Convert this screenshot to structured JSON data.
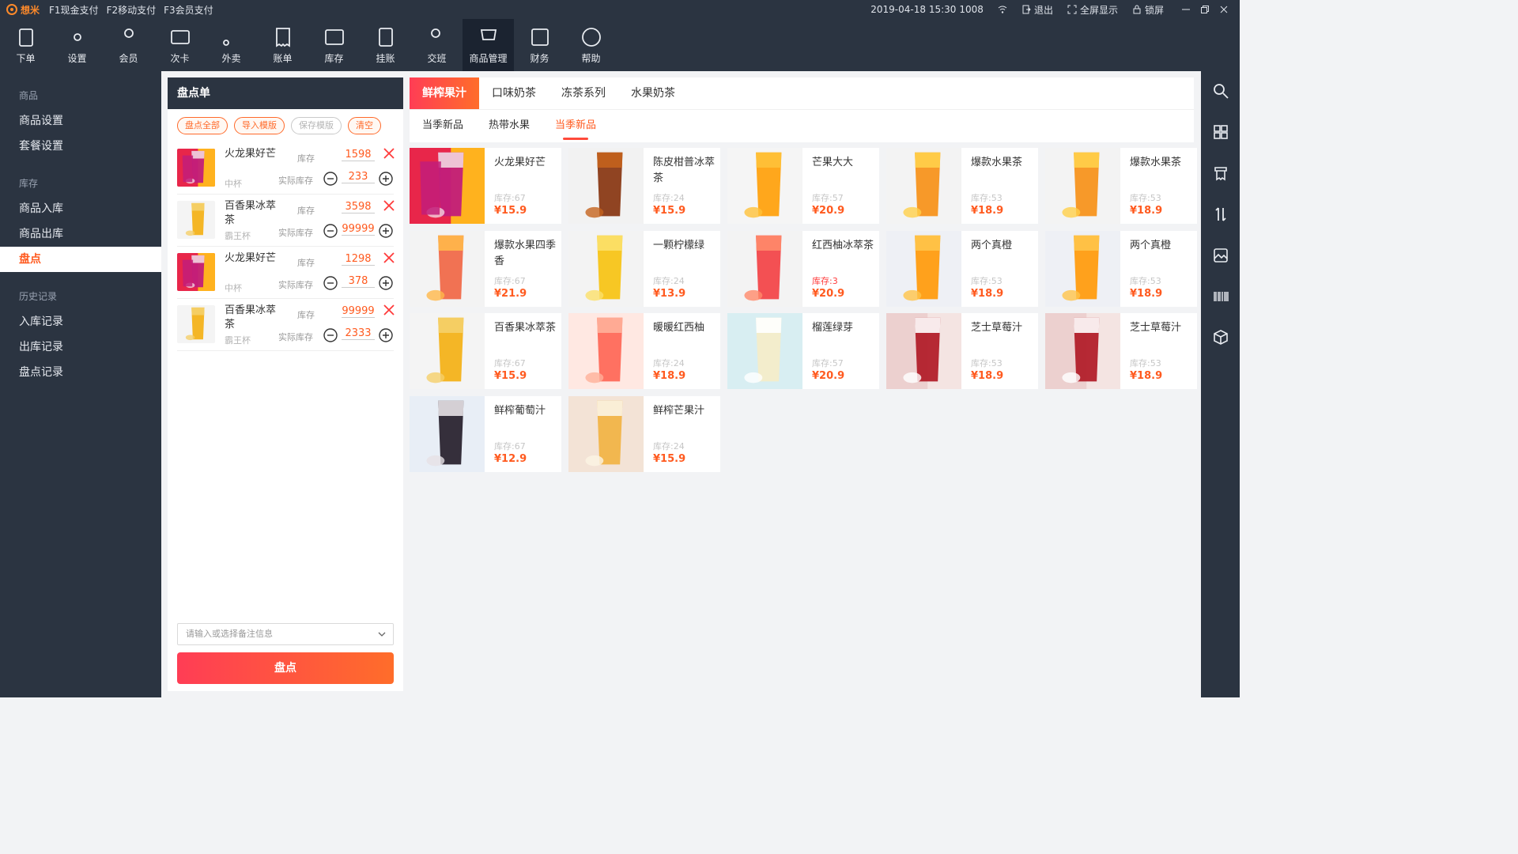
{
  "app": {
    "brand": "想米"
  },
  "topbar": {
    "pay_options": [
      "F1现金支付",
      "F2移动支付",
      "F3会员支付"
    ],
    "datetime": "2019-04-18 15:30",
    "terminal_id": "1008",
    "logout": "退出",
    "fullscreen": "全屏显示",
    "lock": "锁屏"
  },
  "toolbar": [
    {
      "label": "下单",
      "icon": "clipboard-icon"
    },
    {
      "label": "设置",
      "icon": "gear-icon"
    },
    {
      "label": "会员",
      "icon": "user-icon"
    },
    {
      "label": "次卡",
      "icon": "card-icon"
    },
    {
      "label": "外卖",
      "icon": "scooter-icon"
    },
    {
      "label": "账单",
      "icon": "bill-icon"
    },
    {
      "label": "库存",
      "icon": "box-icon"
    },
    {
      "label": "挂账",
      "icon": "ledger-icon"
    },
    {
      "label": "交班",
      "icon": "shift-icon"
    },
    {
      "label": "商品管理",
      "icon": "goods-icon"
    },
    {
      "label": "财务",
      "icon": "finance-icon"
    },
    {
      "label": "帮助",
      "icon": "help-icon"
    }
  ],
  "sidebar": {
    "groups": [
      {
        "title": "商品",
        "items": [
          "商品设置",
          "套餐设置"
        ]
      },
      {
        "title": "库存",
        "items": [
          "商品入库",
          "商品出库",
          "盘点"
        ]
      },
      {
        "title": "历史记录",
        "items": [
          "入库记录",
          "出库记录",
          "盘点记录"
        ]
      }
    ],
    "active": "盘点"
  },
  "panel": {
    "title": "盘点单",
    "buttons": [
      "盘点全部",
      "导入模版",
      "保存模版",
      "清空"
    ],
    "stock_label": "库存",
    "actual_label": "实际库存",
    "rows": [
      {
        "name": "火龙果好芒",
        "spec": "中杯",
        "stock": "1598",
        "actual": "233",
        "img": "pitaya"
      },
      {
        "name": "百香果冰萃茶",
        "spec": "霸王杯",
        "stock": "3598",
        "actual": "99999",
        "img": "passion"
      },
      {
        "name": "火龙果好芒",
        "spec": "中杯",
        "stock": "1298",
        "actual": "378",
        "img": "pitaya"
      },
      {
        "name": "百香果冰萃茶",
        "spec": "霸王杯",
        "stock": "99999",
        "actual": "2333",
        "img": "passion"
      }
    ],
    "remark_placeholder": "请输入或选择备注信息",
    "submit": "盘点"
  },
  "categories": [
    "鲜榨果汁",
    "口味奶茶",
    "冻茶系列",
    "水果奶茶"
  ],
  "active_category": "鲜榨果汁",
  "subcategories": [
    "当季新品",
    "热带水果",
    "当季新品"
  ],
  "active_subcategory_index": 2,
  "products": [
    {
      "name": "火龙果好芒",
      "stock": "库存:67",
      "price": "¥15.9",
      "img": "pitaya"
    },
    {
      "name": "陈皮柑普冰萃茶",
      "stock": "库存:24",
      "price": "¥15.9",
      "img": "tea"
    },
    {
      "name": "芒果大大",
      "stock": "库存:57",
      "price": "¥20.9",
      "img": "mango"
    },
    {
      "name": "爆款水果茶",
      "stock": "库存:53",
      "price": "¥18.9",
      "img": "fruittea"
    },
    {
      "name": "爆款水果茶",
      "stock": "库存:53",
      "price": "¥18.9",
      "img": "fruittea"
    },
    {
      "name": "爆款水果四季香",
      "stock": "库存:67",
      "price": "¥21.9",
      "img": "fourseason"
    },
    {
      "name": "一颗柠檬绿",
      "stock": "库存:24",
      "price": "¥13.9",
      "img": "lemon"
    },
    {
      "name": "红西柚冰萃茶",
      "stock": "库存:3",
      "price": "¥20.9",
      "img": "grapefruit",
      "low": true
    },
    {
      "name": "两个真橙",
      "stock": "库存:53",
      "price": "¥18.9",
      "img": "orange"
    },
    {
      "name": "两个真橙",
      "stock": "库存:53",
      "price": "¥18.9",
      "img": "orange"
    },
    {
      "name": "百香果冰萃茶",
      "stock": "库存:67",
      "price": "¥15.9",
      "img": "passion"
    },
    {
      "name": "暖暖红西柚",
      "stock": "库存:24",
      "price": "¥18.9",
      "img": "warmgrapefruit"
    },
    {
      "name": "榴莲绿芽",
      "stock": "库存:57",
      "price": "¥20.9",
      "img": "durian"
    },
    {
      "name": "芝士草莓汁",
      "stock": "库存:53",
      "price": "¥18.9",
      "img": "strawberry"
    },
    {
      "name": "芝士草莓汁",
      "stock": "库存:53",
      "price": "¥18.9",
      "img": "strawberry"
    },
    {
      "name": "鲜榨葡萄汁",
      "stock": "库存:67",
      "price": "¥12.9",
      "img": "grape"
    },
    {
      "name": "鲜榨芒果汁",
      "stock": "库存:24",
      "price": "¥15.9",
      "img": "mangojuice"
    }
  ],
  "rightbar_icons": [
    "search-icon",
    "grid-icon",
    "printer-icon",
    "sort-icon",
    "image-icon",
    "barcode-icon",
    "package-icon"
  ],
  "colors": {
    "accent": "#ff5a1f",
    "dark": "#2b3441",
    "gradient_start": "#ff3d55",
    "gradient_end": "#ff6d2a"
  }
}
